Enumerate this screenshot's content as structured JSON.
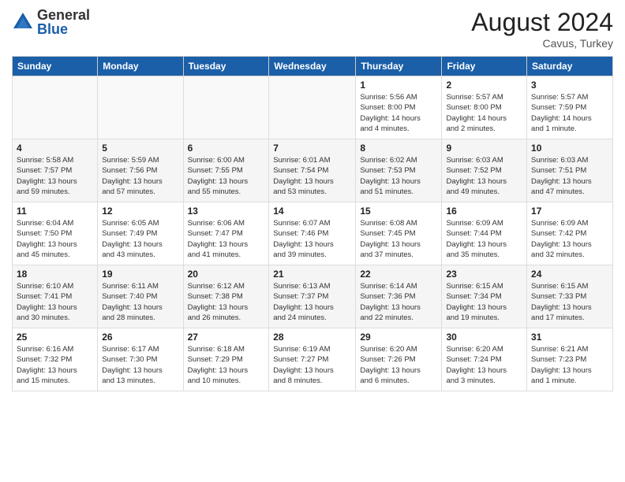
{
  "header": {
    "logo_general": "General",
    "logo_blue": "Blue",
    "month_year": "August 2024",
    "location": "Cavus, Turkey"
  },
  "days_of_week": [
    "Sunday",
    "Monday",
    "Tuesday",
    "Wednesday",
    "Thursday",
    "Friday",
    "Saturday"
  ],
  "weeks": [
    [
      {
        "day": "",
        "info": ""
      },
      {
        "day": "",
        "info": ""
      },
      {
        "day": "",
        "info": ""
      },
      {
        "day": "",
        "info": ""
      },
      {
        "day": "1",
        "info": "Sunrise: 5:56 AM\nSunset: 8:00 PM\nDaylight: 14 hours\nand 4 minutes."
      },
      {
        "day": "2",
        "info": "Sunrise: 5:57 AM\nSunset: 8:00 PM\nDaylight: 14 hours\nand 2 minutes."
      },
      {
        "day": "3",
        "info": "Sunrise: 5:57 AM\nSunset: 7:59 PM\nDaylight: 14 hours\nand 1 minute."
      }
    ],
    [
      {
        "day": "4",
        "info": "Sunrise: 5:58 AM\nSunset: 7:57 PM\nDaylight: 13 hours\nand 59 minutes."
      },
      {
        "day": "5",
        "info": "Sunrise: 5:59 AM\nSunset: 7:56 PM\nDaylight: 13 hours\nand 57 minutes."
      },
      {
        "day": "6",
        "info": "Sunrise: 6:00 AM\nSunset: 7:55 PM\nDaylight: 13 hours\nand 55 minutes."
      },
      {
        "day": "7",
        "info": "Sunrise: 6:01 AM\nSunset: 7:54 PM\nDaylight: 13 hours\nand 53 minutes."
      },
      {
        "day": "8",
        "info": "Sunrise: 6:02 AM\nSunset: 7:53 PM\nDaylight: 13 hours\nand 51 minutes."
      },
      {
        "day": "9",
        "info": "Sunrise: 6:03 AM\nSunset: 7:52 PM\nDaylight: 13 hours\nand 49 minutes."
      },
      {
        "day": "10",
        "info": "Sunrise: 6:03 AM\nSunset: 7:51 PM\nDaylight: 13 hours\nand 47 minutes."
      }
    ],
    [
      {
        "day": "11",
        "info": "Sunrise: 6:04 AM\nSunset: 7:50 PM\nDaylight: 13 hours\nand 45 minutes."
      },
      {
        "day": "12",
        "info": "Sunrise: 6:05 AM\nSunset: 7:49 PM\nDaylight: 13 hours\nand 43 minutes."
      },
      {
        "day": "13",
        "info": "Sunrise: 6:06 AM\nSunset: 7:47 PM\nDaylight: 13 hours\nand 41 minutes."
      },
      {
        "day": "14",
        "info": "Sunrise: 6:07 AM\nSunset: 7:46 PM\nDaylight: 13 hours\nand 39 minutes."
      },
      {
        "day": "15",
        "info": "Sunrise: 6:08 AM\nSunset: 7:45 PM\nDaylight: 13 hours\nand 37 minutes."
      },
      {
        "day": "16",
        "info": "Sunrise: 6:09 AM\nSunset: 7:44 PM\nDaylight: 13 hours\nand 35 minutes."
      },
      {
        "day": "17",
        "info": "Sunrise: 6:09 AM\nSunset: 7:42 PM\nDaylight: 13 hours\nand 32 minutes."
      }
    ],
    [
      {
        "day": "18",
        "info": "Sunrise: 6:10 AM\nSunset: 7:41 PM\nDaylight: 13 hours\nand 30 minutes."
      },
      {
        "day": "19",
        "info": "Sunrise: 6:11 AM\nSunset: 7:40 PM\nDaylight: 13 hours\nand 28 minutes."
      },
      {
        "day": "20",
        "info": "Sunrise: 6:12 AM\nSunset: 7:38 PM\nDaylight: 13 hours\nand 26 minutes."
      },
      {
        "day": "21",
        "info": "Sunrise: 6:13 AM\nSunset: 7:37 PM\nDaylight: 13 hours\nand 24 minutes."
      },
      {
        "day": "22",
        "info": "Sunrise: 6:14 AM\nSunset: 7:36 PM\nDaylight: 13 hours\nand 22 minutes."
      },
      {
        "day": "23",
        "info": "Sunrise: 6:15 AM\nSunset: 7:34 PM\nDaylight: 13 hours\nand 19 minutes."
      },
      {
        "day": "24",
        "info": "Sunrise: 6:15 AM\nSunset: 7:33 PM\nDaylight: 13 hours\nand 17 minutes."
      }
    ],
    [
      {
        "day": "25",
        "info": "Sunrise: 6:16 AM\nSunset: 7:32 PM\nDaylight: 13 hours\nand 15 minutes."
      },
      {
        "day": "26",
        "info": "Sunrise: 6:17 AM\nSunset: 7:30 PM\nDaylight: 13 hours\nand 13 minutes."
      },
      {
        "day": "27",
        "info": "Sunrise: 6:18 AM\nSunset: 7:29 PM\nDaylight: 13 hours\nand 10 minutes."
      },
      {
        "day": "28",
        "info": "Sunrise: 6:19 AM\nSunset: 7:27 PM\nDaylight: 13 hours\nand 8 minutes."
      },
      {
        "day": "29",
        "info": "Sunrise: 6:20 AM\nSunset: 7:26 PM\nDaylight: 13 hours\nand 6 minutes."
      },
      {
        "day": "30",
        "info": "Sunrise: 6:20 AM\nSunset: 7:24 PM\nDaylight: 13 hours\nand 3 minutes."
      },
      {
        "day": "31",
        "info": "Sunrise: 6:21 AM\nSunset: 7:23 PM\nDaylight: 13 hours\nand 1 minute."
      }
    ]
  ]
}
